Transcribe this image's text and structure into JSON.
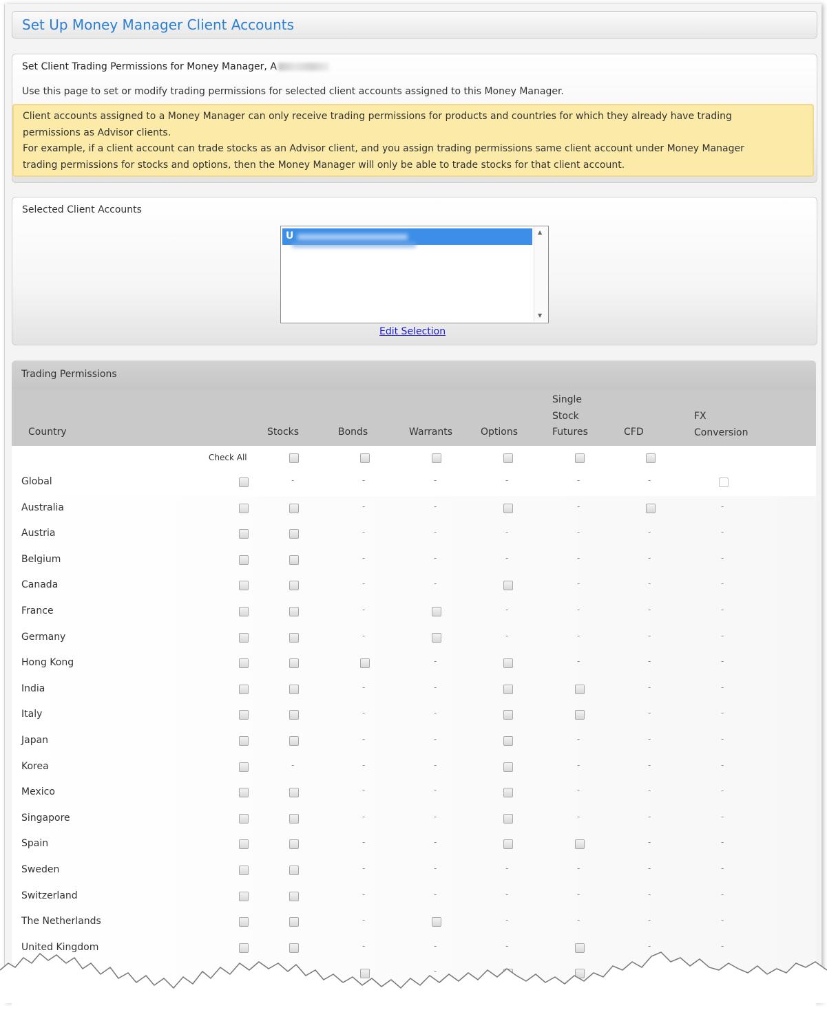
{
  "page_title": "Set Up Money Manager Client Accounts",
  "intro": {
    "heading": "Set Client Trading Permissions for Money Manager, A",
    "description": "Use this page to set or modify trading permissions for selected client accounts assigned to this Money Manager.",
    "notice_line1": "Client accounts assigned to a Money Manager can only receive trading permissions for products and countries for which they already have trading",
    "notice_line2": "permissions as Advisor clients.",
    "notice_line3": "For example, if a client account can trade stocks as an Advisor client, and you assign trading permissions same client account under Money Manager",
    "notice_line4": "trading permissions for stocks and options, then the Money Manager will only be able to trade stocks for that client account."
  },
  "selected_accounts": {
    "heading": "Selected Client Accounts",
    "items": [
      "U"
    ],
    "edit_link": "Edit Selection"
  },
  "trading_permissions": {
    "heading": "Trading Permissions",
    "columns": {
      "country": "Country",
      "stocks": "Stocks",
      "bonds": "Bonds",
      "warrants": "Warrants",
      "options": "Options",
      "ssf_line1": "Single",
      "ssf_line2": "Stock",
      "ssf_line3": "Futures",
      "cfd": "CFD",
      "fx_line1": "FX",
      "fx_line2": "Conversion"
    },
    "check_all_label": "Check All",
    "dash": "-",
    "rows": [
      {
        "country": "Global",
        "cells": [
          "-",
          "-",
          "-",
          "-",
          "-",
          "-",
          "box"
        ]
      },
      {
        "country": "Australia",
        "cells": [
          "box",
          "-",
          "-",
          "box",
          "-",
          "box",
          "-"
        ]
      },
      {
        "country": "Austria",
        "cells": [
          "box",
          "-",
          "-",
          "-",
          "-",
          "-",
          "-"
        ]
      },
      {
        "country": "Belgium",
        "cells": [
          "box",
          "-",
          "-",
          "-",
          "-",
          "-",
          "-"
        ]
      },
      {
        "country": "Canada",
        "cells": [
          "box",
          "-",
          "-",
          "box",
          "-",
          "-",
          "-"
        ]
      },
      {
        "country": "France",
        "cells": [
          "box",
          "-",
          "box",
          "-",
          "-",
          "-",
          "-"
        ]
      },
      {
        "country": "Germany",
        "cells": [
          "box",
          "-",
          "box",
          "-",
          "-",
          "-",
          "-"
        ]
      },
      {
        "country": "Hong Kong",
        "cells": [
          "box",
          "box",
          "-",
          "box",
          "-",
          "-",
          "-"
        ]
      },
      {
        "country": "India",
        "cells": [
          "box",
          "-",
          "-",
          "box",
          "box",
          "-",
          "-"
        ]
      },
      {
        "country": "Italy",
        "cells": [
          "box",
          "-",
          "-",
          "box",
          "box",
          "-",
          "-"
        ]
      },
      {
        "country": "Japan",
        "cells": [
          "box",
          "-",
          "-",
          "box",
          "-",
          "-",
          "-"
        ]
      },
      {
        "country": "Korea",
        "cells": [
          "-",
          "-",
          "-",
          "box",
          "-",
          "-",
          "-"
        ]
      },
      {
        "country": "Mexico",
        "cells": [
          "box",
          "-",
          "-",
          "box",
          "-",
          "-",
          "-"
        ]
      },
      {
        "country": "Singapore",
        "cells": [
          "box",
          "-",
          "-",
          "box",
          "-",
          "-",
          "-"
        ]
      },
      {
        "country": "Spain",
        "cells": [
          "box",
          "-",
          "-",
          "box",
          "box",
          "-",
          "-"
        ]
      },
      {
        "country": "Sweden",
        "cells": [
          "box",
          "-",
          "-",
          "-",
          "-",
          "-",
          "-"
        ]
      },
      {
        "country": "Switzerland",
        "cells": [
          "box",
          "-",
          "-",
          "-",
          "-",
          "-",
          "-"
        ]
      },
      {
        "country": "The Netherlands",
        "cells": [
          "box",
          "-",
          "box",
          "-",
          "-",
          "-",
          "-"
        ]
      },
      {
        "country": "United Kingdom",
        "cells": [
          "box",
          "-",
          "-",
          "-",
          "box",
          "-",
          "-"
        ]
      },
      {
        "country": "",
        "cells": [
          "box",
          "box",
          "-",
          "box",
          "box",
          "-",
          "-"
        ]
      }
    ]
  },
  "colors": {
    "title_blue": "#2a7fd3",
    "notice_bg": "#fbeaa8",
    "selection_blue": "#3d8ee6",
    "link_blue": "#1a1ad0"
  }
}
